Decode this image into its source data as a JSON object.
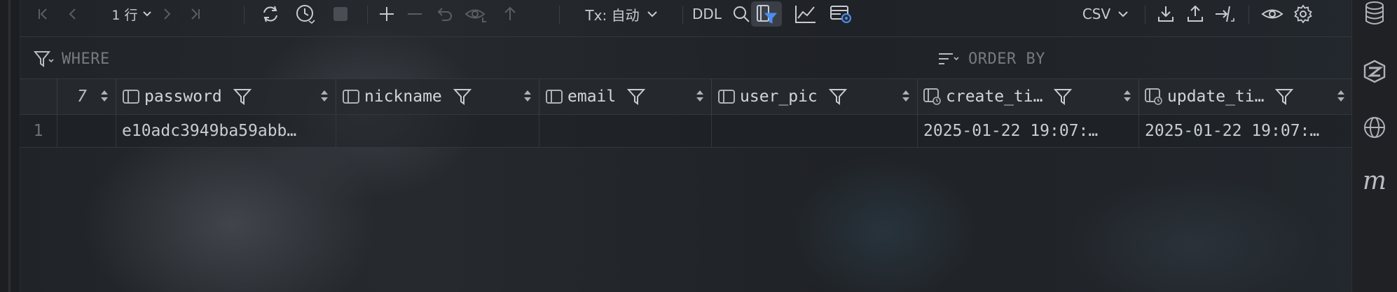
{
  "toolbar": {
    "rows_label": "1 行",
    "tx_label": "Tx: 自动",
    "ddl_label": "DDL",
    "export_format": "CSV",
    "icons": [
      "first-page-icon",
      "prev-page-icon",
      "next-page-icon",
      "last-page-icon",
      "reload-icon",
      "history-icon",
      "stop-icon",
      "add-row-icon",
      "remove-row-icon",
      "revert-icon",
      "preview-changes-icon",
      "submit-icon",
      "search-icon",
      "filter-panel-icon",
      "chart-icon",
      "table-settings-icon",
      "download-icon",
      "upload-icon",
      "compare-icon",
      "view-icon",
      "gear-icon"
    ]
  },
  "filter": {
    "where_label": "WHERE",
    "order_by_label": "ORDER BY"
  },
  "grid": {
    "columns": [
      {
        "label": "7",
        "type": "truncated"
      },
      {
        "label": "password",
        "type": "text"
      },
      {
        "label": "nickname",
        "type": "text"
      },
      {
        "label": "email",
        "type": "text"
      },
      {
        "label": "user_pic",
        "type": "text"
      },
      {
        "label": "create_ti…",
        "type": "datetime"
      },
      {
        "label": "update_ti…",
        "type": "datetime"
      }
    ],
    "rows": [
      {
        "num": "1",
        "cells": [
          "",
          "e10adc3949ba59abb…",
          "",
          "",
          "",
          "2025-01-22 19:07:…",
          "2025-01-22 19:07:…"
        ]
      }
    ]
  },
  "rightbar": {
    "icons": [
      "database-icon",
      "ai-assistant-icon",
      "globe-icon",
      "maven-icon"
    ],
    "maven_label": "m"
  }
}
